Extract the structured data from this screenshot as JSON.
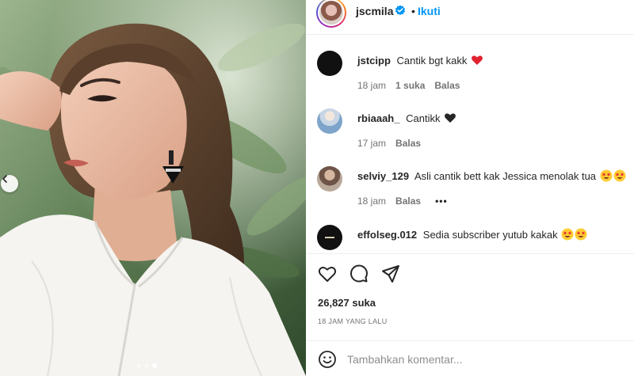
{
  "post": {
    "author": "jscmila",
    "follow_label": "Ikuti",
    "separator": "•",
    "carousel": {
      "dots": 3,
      "active": 3
    }
  },
  "comments": [
    {
      "user": "jstcipp",
      "text": "Cantik bgt kakk",
      "trailing_icon": "red-heart-icon",
      "time": "18 jam",
      "likes": "1 suka",
      "reply": "Balas",
      "more": ""
    },
    {
      "user": "rbiaaah_",
      "text": "Cantikk",
      "trailing_icon": "black-heart-icon",
      "time": "17 jam",
      "likes": "",
      "reply": "Balas",
      "more": ""
    },
    {
      "user": "selviy_129",
      "text": "Asli cantik bett kak Jessica menolak tua",
      "trailing_icon": "star-struck-emoji x2",
      "time": "18 jam",
      "likes": "",
      "reply": "Balas",
      "more": "•••"
    },
    {
      "user": "effolseg.012",
      "text": "Sedia subscriber yutub kakak",
      "trailing_icon": "star-struck-emoji x2",
      "time": "",
      "likes": "",
      "reply": "",
      "more": ""
    }
  ],
  "actions": {
    "like_icon": "heart-outline-icon",
    "comment_icon": "comment-bubble-icon",
    "share_icon": "paper-plane-icon",
    "likes_count": "26,827 suka",
    "timestamp": "18 JAM YANG LALU"
  },
  "composer": {
    "emoji_icon": "smiley-icon",
    "placeholder": "Tambahkan komentar..."
  },
  "colors": {
    "accent": "#0095f6",
    "heart_red": "#ed4956",
    "muted": "#737373",
    "divider": "#efefef"
  }
}
